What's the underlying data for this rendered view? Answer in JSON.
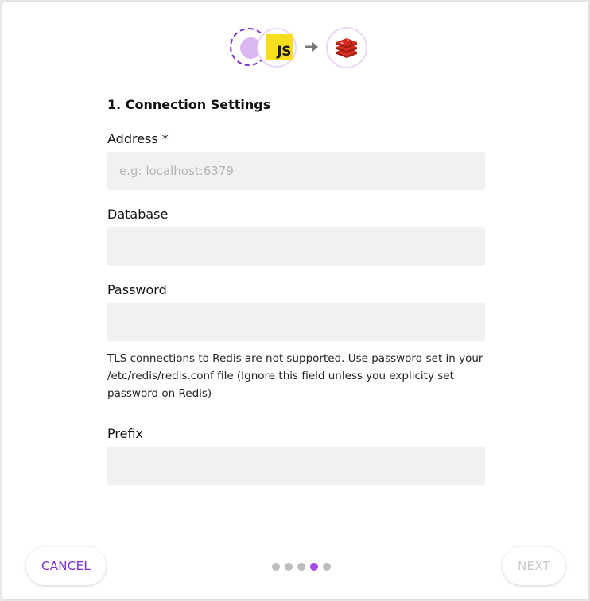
{
  "header": {
    "source_icon": "source-dot-icon",
    "connector_icon": "javascript-icon",
    "connector_label": "JS",
    "arrow_icon": "arrow-right-icon",
    "destination_icon": "redis-icon"
  },
  "form": {
    "section_title": "1. Connection Settings",
    "address": {
      "label": "Address *",
      "placeholder": "e.g: localhost:6379",
      "value": ""
    },
    "database": {
      "label": "Database",
      "placeholder": "",
      "value": ""
    },
    "password": {
      "label": "Password",
      "placeholder": "",
      "value": "",
      "help": "TLS connections to Redis are not supported. Use password set in your /etc/redis/redis.conf file (Ignore this field unless you explicity set password on Redis)"
    },
    "prefix": {
      "label": "Prefix",
      "placeholder": "",
      "value": ""
    }
  },
  "footer": {
    "cancel_label": "CANCEL",
    "next_label": "NEXT",
    "steps_total": 5,
    "current_step": 4
  },
  "colors": {
    "accent": "#7a2fd6",
    "step_active": "#a64be8",
    "step_inactive": "#bdbdbd",
    "input_bg": "#f1f1f1",
    "js_yellow": "#f7df1e",
    "redis_red": "#d82c20"
  }
}
